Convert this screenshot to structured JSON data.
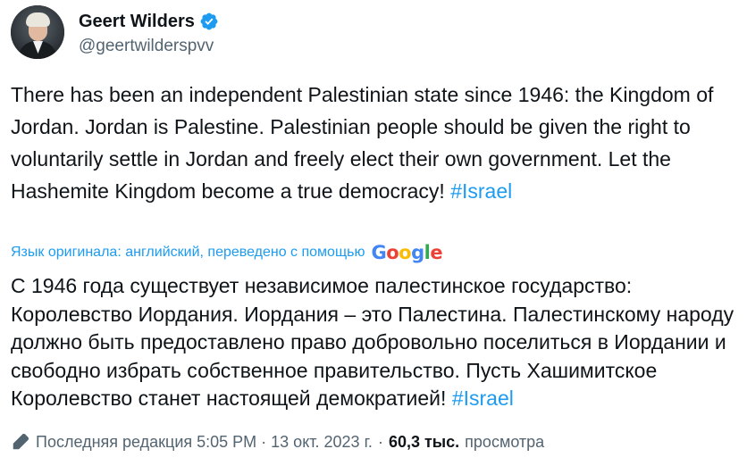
{
  "author": {
    "display_name": "Geert Wilders",
    "handle": "@geertwilderspvv",
    "verified": true,
    "verified_color": "#1d9bf0"
  },
  "tweet": {
    "text": "There has been an independent Palestinian state since 1946: the Kingdom of Jordan. Jordan is Palestine. Palestinian people should be given the right to voluntarily settle in Jordan and freely elect their own government. Let the Hashemite Kingdom become a true democracy!",
    "hashtag": "#Israel"
  },
  "translation": {
    "note": "Язык оригинала: английский, переведено с помощью",
    "provider": "Google",
    "text": "С 1946 года существует независимое палестинское государство: Королевство Иордания. Иордания – это Палестина. Палестинскому народу должно быть предоставлено право добровольно поселиться в Иордании и свободно избрать собственное правительство. Пусть Хашимитское Королевство станет настоящей демократией!",
    "hashtag": "#Israel"
  },
  "meta": {
    "edit_label": "Последняя редакция 5:05 PM · 13 окт. 2023 г.",
    "separator": "·",
    "views_count": "60,3 тыс.",
    "views_label": "просмотра"
  },
  "icons": {
    "verified": "verified-badge-icon",
    "edit": "pencil-icon"
  },
  "colors": {
    "link": "#1d9bf0",
    "text": "#0f1419",
    "secondary": "#536471"
  }
}
